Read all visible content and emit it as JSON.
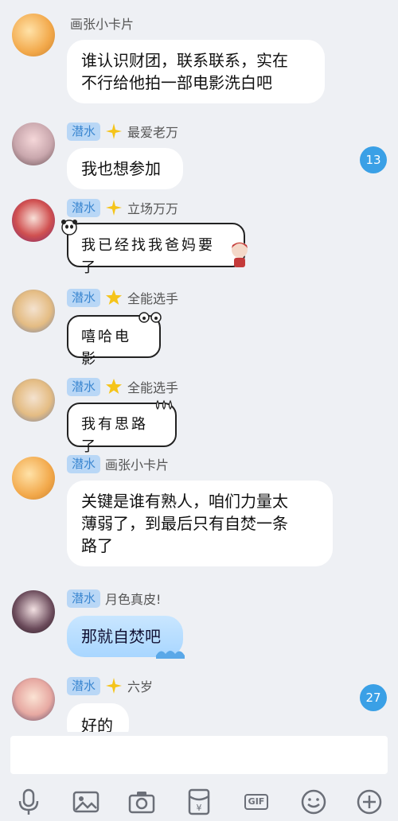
{
  "messages": [
    {
      "badge": "",
      "name": "画张小卡片",
      "text_lines": [
        "谁认识财团，联系联系，实在",
        "不行给他拍一部电影洗白吧"
      ]
    },
    {
      "badge": "潜水",
      "name": "最爱老万",
      "text": "我也想参加",
      "unread": "13"
    },
    {
      "badge": "潜水",
      "name": "立场万万",
      "text": "我已经找我爸妈要了"
    },
    {
      "badge": "潜水",
      "name": "全能选手",
      "text": "嘻哈电影"
    },
    {
      "badge": "潜水",
      "name": "全能选手",
      "text": "我有思路了"
    },
    {
      "badge": "潜水",
      "name": "画张小卡片",
      "text_lines": [
        "关键是谁有熟人，咱们力量太",
        "薄弱了，到最后只有自焚一条",
        "路了"
      ]
    },
    {
      "badge": "潜水",
      "name": "月色真皮!",
      "text": "那就自焚吧"
    },
    {
      "badge": "潜水",
      "name": "六岁",
      "text": "好的",
      "unread": "27"
    }
  ],
  "toolbar": {
    "gif_label": "GIF"
  },
  "colors": {
    "background": "#eef0f4",
    "badge_bg": "#b9d7f6",
    "badge_text": "#3a86d0",
    "unread": "#3aa0e6"
  }
}
